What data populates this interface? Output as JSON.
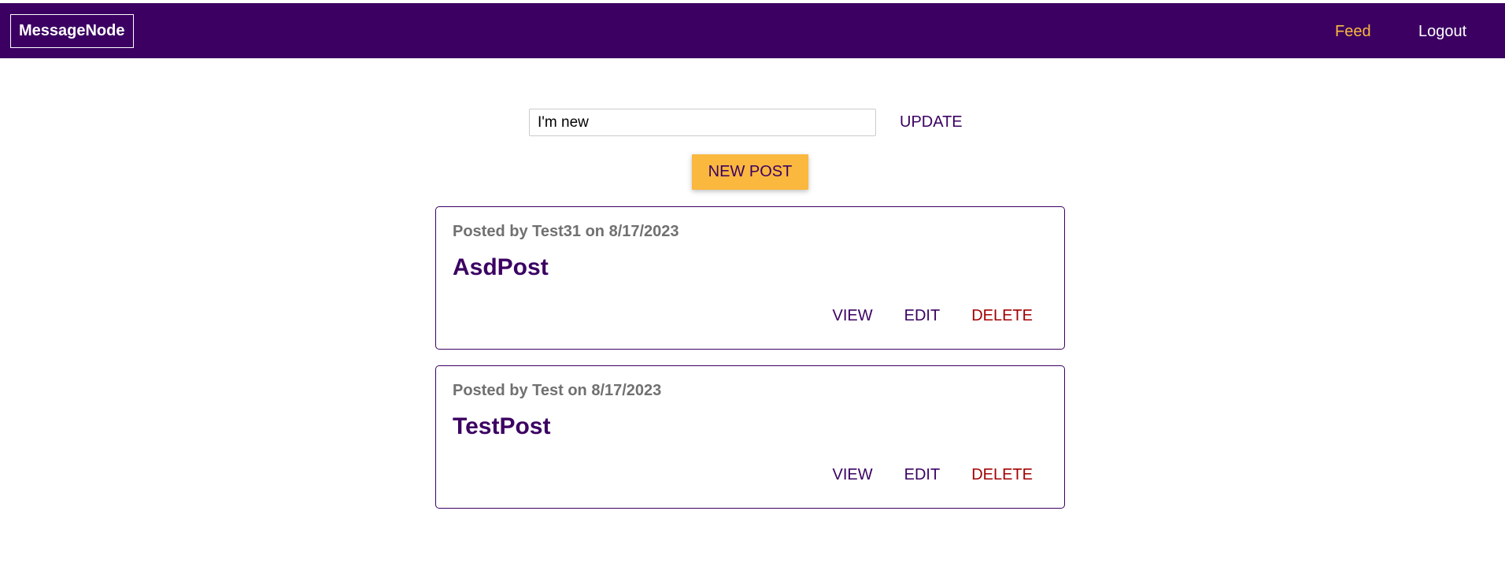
{
  "header": {
    "logo": "MessageNode",
    "nav": {
      "feed": "Feed",
      "logout": "Logout"
    },
    "colors": {
      "bar": "#3b0062",
      "active_link": "#fab83f"
    }
  },
  "status": {
    "value": "I'm new",
    "update_label": "UPDATE"
  },
  "new_post_label": "NEW POST",
  "posts": [
    {
      "meta": "Posted by Test31 on 8/17/2023",
      "title": "AsdPost",
      "actions": {
        "view": "VIEW",
        "edit": "EDIT",
        "delete": "DELETE"
      }
    },
    {
      "meta": "Posted by Test on 8/17/2023",
      "title": "TestPost",
      "actions": {
        "view": "VIEW",
        "edit": "EDIT",
        "delete": "DELETE"
      }
    }
  ]
}
